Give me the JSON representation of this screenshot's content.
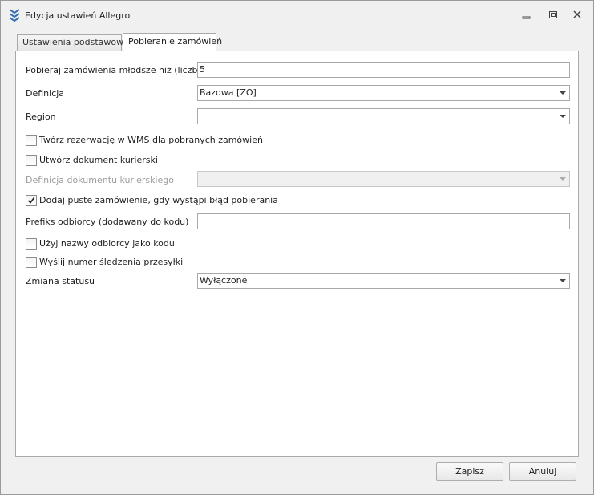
{
  "window": {
    "title": "Edycja ustawień Allegro"
  },
  "tabs": [
    {
      "label": "Ustawienia podstawowe",
      "active": false
    },
    {
      "label": "Pobieranie zamówień",
      "active": true
    }
  ],
  "form": {
    "days_label": "Pobieraj zamówienia młodsze niż (liczba dni)",
    "days_value": "5",
    "definition_label": "Definicja",
    "definition_value": "Bazowa [ZO]",
    "region_label": "Region",
    "region_value": "",
    "wms_reservation_label": "Twórz rezerwację w WMS dla pobranych zamówień",
    "wms_reservation_checked": false,
    "courier_doc_label": "Utwórz dokument kurierski",
    "courier_doc_checked": false,
    "courier_doc_def_label": "Definicja dokumentu kurierskiego",
    "courier_doc_def_value": "",
    "empty_order_label": "Dodaj puste zamówienie, gdy wystąpi błąd pobierania",
    "empty_order_checked": true,
    "recipient_prefix_label": "Prefiks odbiorcy (dodawany do kodu)",
    "recipient_prefix_value": "",
    "use_recipient_name_label": "Użyj nazwy odbiorcy jako kodu",
    "use_recipient_name_checked": false,
    "send_tracking_label": "Wyślij numer śledzenia przesyłki",
    "send_tracking_checked": false,
    "status_change_label": "Zmiana statusu",
    "status_change_value": "Wyłączone"
  },
  "footer": {
    "save_label": "Zapisz",
    "cancel_label": "Anuluj"
  },
  "colors": {
    "icon_blue": "#3a6fb3",
    "border": "#a9a9a9",
    "panel_bg": "#ffffff",
    "window_bg": "#f0f0f0"
  }
}
